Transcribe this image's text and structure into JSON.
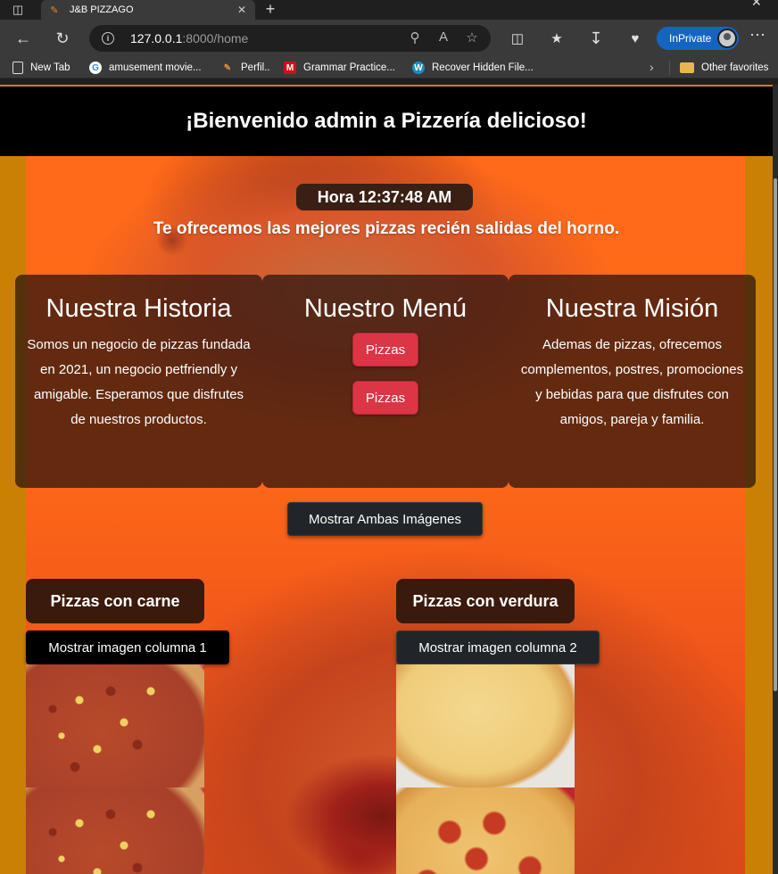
{
  "browser": {
    "tab_title": "J&B PIZZAGO",
    "url_host": "127.0.0.1",
    "url_rest": ":8000/home",
    "inprivate_label": "InPrivate",
    "bookmarks": [
      {
        "label": "New Tab",
        "icon": "page-icon"
      },
      {
        "label": "amusement movie...",
        "icon": "google-icon"
      },
      {
        "label": "Perfil..",
        "icon": "pencil-icon"
      },
      {
        "label": "Grammar Practice...",
        "icon": "m-logo-icon"
      },
      {
        "label": "Recover Hidden File...",
        "icon": "wordpress-icon"
      }
    ],
    "other_favorites": "Other favorites"
  },
  "header": {
    "title": "¡Bienvenido admin a Pizzería delicioso!"
  },
  "clock": {
    "text": "Hora 12:37:48 AM"
  },
  "tagline": "Te ofrecemos las mejores pizzas recién salidas del horno.",
  "cards": {
    "history": {
      "title": "Nuestra Historia",
      "text": "Somos un negocio de pizzas fundada en 2021, un negocio petfriendly y amigable. Esperamos que disfrutes de nuestros productos."
    },
    "menu": {
      "title": "Nuestro Menú",
      "buttons": [
        "Pizzas",
        "Pizzas"
      ]
    },
    "mission": {
      "title": "Nuestra Misión",
      "text": "Ademas de pizzas, ofrecemos complementos, postres, promociones y bebidas para que disfrutes con amigos, pareja y familia."
    }
  },
  "show_both_button": "Mostrar Ambas Imágenes",
  "columns": [
    {
      "label": "Pizzas con carne",
      "button": "Mostrar imagen columna 1"
    },
    {
      "label": "Pizzas con verdura",
      "button": "Mostrar imagen columna 2"
    }
  ],
  "colors": {
    "page_bg": "#c98005",
    "header_bg": "#000000",
    "accent_red": "#dc3545",
    "dark_button": "#212529"
  }
}
